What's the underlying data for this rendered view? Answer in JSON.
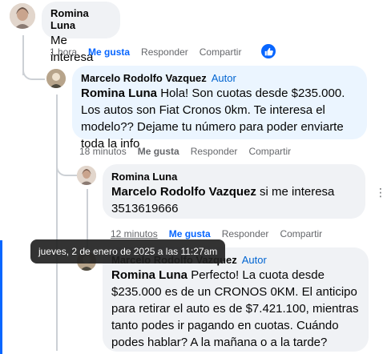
{
  "comments": [
    {
      "author": "Romina Luna",
      "text": "Me interesa",
      "actions": {
        "time": "1 hora",
        "like": "Me gusta",
        "reply": "Responder",
        "share": "Compartir"
      }
    },
    {
      "author": "Marcelo Rodolfo Vazquez",
      "badge": "Autor",
      "mention": "Romina Luna",
      "text": "Hola! Son cuotas desde $235.000. Los autos son Fiat Cronos 0km. Te interesa el modelo?? Dejame tu número para poder enviarte toda la info",
      "actions": {
        "time": "18 minutos",
        "like": "Me gusta",
        "reply": "Responder",
        "share": "Compartir"
      }
    },
    {
      "author": "Romina Luna",
      "mention": "Marcelo Rodolfo Vazquez",
      "text": "si me interesa 3513619666",
      "actions": {
        "time": "12 minutos",
        "like": "Me gusta",
        "reply": "Responder",
        "share": "Compartir"
      },
      "more": "⋮"
    },
    {
      "author": "Marcelo Rodolfo Vazquez",
      "badge": "Autor",
      "mention": "Romina Luna",
      "text": "Perfecto! La cuota desde $235.000 es de un CRONOS 0KM. El anticipo para retirar el auto es de $7.421.100, mientras tanto podes ir pagando en cuotas. Cuándo podes hablar? A la mañana o a la tarde?"
    }
  ],
  "tooltip": "jueves, 2 de enero de 2025 a las 11:27am",
  "colors": {
    "like_blue": "#0866ff",
    "author_badge": "#0064d1",
    "bubble": "#f0f2f5",
    "bubble_highlight": "#ebf5ff"
  },
  "icons": {
    "reaction": "thumbs-up-icon",
    "more": "more-options-icon"
  }
}
